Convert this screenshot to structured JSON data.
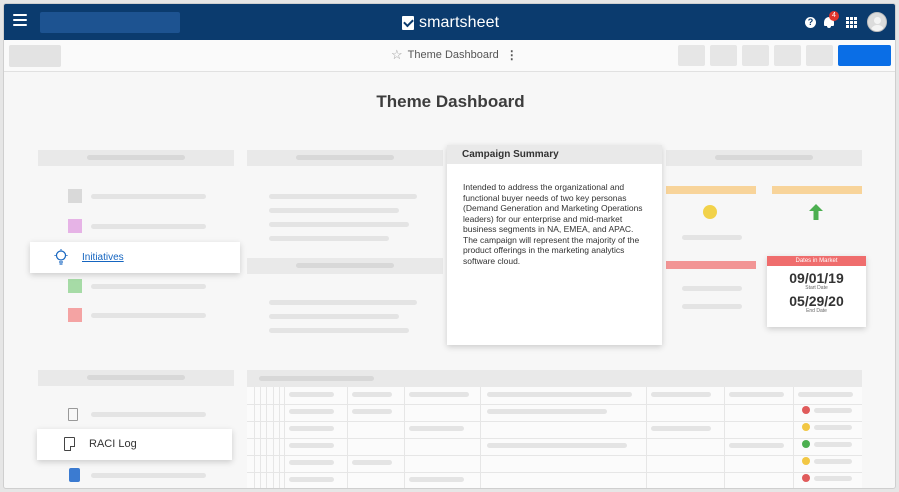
{
  "header": {
    "brand": "smartsheet",
    "notification_count": "4",
    "help_glyph": "?"
  },
  "toolbar": {
    "sheet_title": "Theme Dashboard",
    "star_icon": "star-icon",
    "more_icon": "more-vertical-icon"
  },
  "dashboard": {
    "title": "Theme Dashboard",
    "initiatives_link": "Initiatives",
    "raci_log_label": "RACI Log",
    "summary": {
      "heading": "Campaign Summary",
      "body": "Intended to address the organizational and functional buyer needs of two key personas (Demand Generation and Marketing Operations leaders) for our enterprise and mid-market business segments in NA, EMEA, and APAC. The campaign will represent the majority of the product offerings in the marketing analytics software cloud."
    },
    "dates": {
      "heading": "Dates in Market",
      "start_value": "09/01/19",
      "start_label": "Start Date",
      "end_value": "05/29/20",
      "end_label": "End Date"
    }
  },
  "colors": {
    "topbar": "#0b3b6e",
    "primary_button": "#0a6ee6",
    "link": "#1565c0",
    "dates_header": "#ef6d6d",
    "status_red": "#ef6d6d",
    "status_yellow": "#f2c744",
    "status_green": "#4caf50"
  }
}
